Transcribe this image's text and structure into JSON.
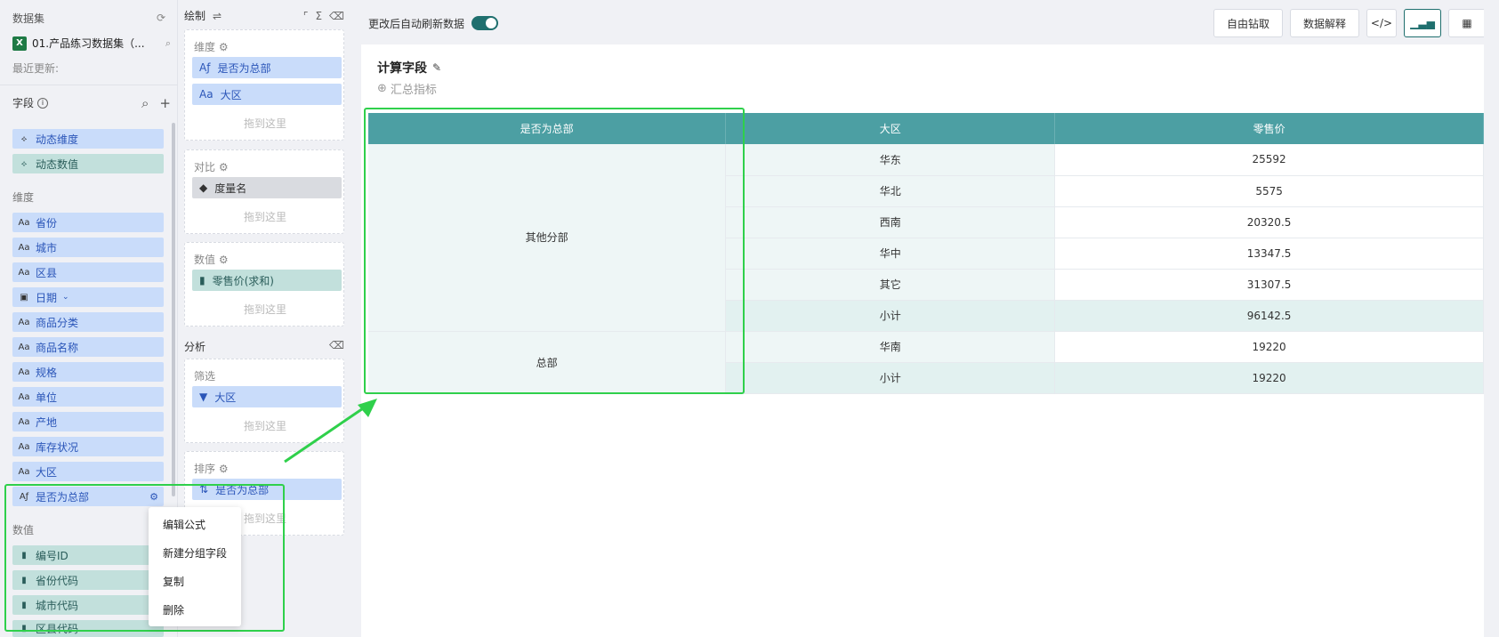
{
  "left": {
    "dataset_title": "数据集",
    "dataset_name": "01.产品练习数据集（...",
    "last_updated": "最近更新:",
    "fields_label": "字段",
    "dynamic": [
      {
        "label": "动态维度",
        "kind": "dim"
      },
      {
        "label": "动态数值",
        "kind": "meas"
      }
    ],
    "dimension_label": "维度",
    "dimensions": [
      "省份",
      "城市",
      "区县",
      "日期",
      "商品分类",
      "商品名称",
      "规格",
      "单位",
      "产地",
      "库存状况",
      "大区",
      "是否为总部"
    ],
    "measure_label": "数值",
    "measures": [
      "编号ID",
      "省份代码",
      "城市代码",
      "区县代码"
    ]
  },
  "context_menu": [
    "编辑公式",
    "新建分组字段",
    "复制",
    "删除"
  ],
  "mid": {
    "draw_label": "绘制",
    "dim_box": {
      "label": "维度",
      "pills": [
        "是否为总部",
        "大区"
      ],
      "drop": "拖到这里"
    },
    "compare_box": {
      "label": "对比",
      "pill": "度量名",
      "drop": "拖到这里"
    },
    "value_box": {
      "label": "数值",
      "pill": "零售价(求和)",
      "drop": "拖到这里"
    },
    "analysis_label": "分析",
    "filter_box": {
      "label": "筛选",
      "pill": "大区",
      "drop": "拖到这里"
    },
    "sort_box": {
      "label": "排序",
      "pill": "是否为总部",
      "drop": "拖到这里"
    }
  },
  "main": {
    "auto_refresh_label": "更改后自动刷新数据",
    "auto_refresh_on": true,
    "buttons": {
      "drill": "自由钻取",
      "explain": "数据解释"
    },
    "calc_title": "计算字段",
    "summary_metric": "汇总指标",
    "table": {
      "headers": [
        "是否为总部",
        "大区",
        "零售价"
      ],
      "groups": [
        {
          "name": "其他分部",
          "rows": [
            [
              "华东",
              "25592"
            ],
            [
              "华北",
              "5575"
            ],
            [
              "西南",
              "20320.5"
            ],
            [
              "华中",
              "13347.5"
            ],
            [
              "其它",
              "31307.5"
            ],
            [
              "小计",
              "96142.5"
            ]
          ]
        },
        {
          "name": "总部",
          "rows": [
            [
              "华南",
              "19220"
            ],
            [
              "小计",
              "19220"
            ]
          ]
        }
      ]
    }
  },
  "colors": {
    "accent": "#1f6f6e",
    "header": "#4c9fa3",
    "highlight": "#2fd04b",
    "dim": "#c9dcfa",
    "meas": "#c2e0dc"
  }
}
